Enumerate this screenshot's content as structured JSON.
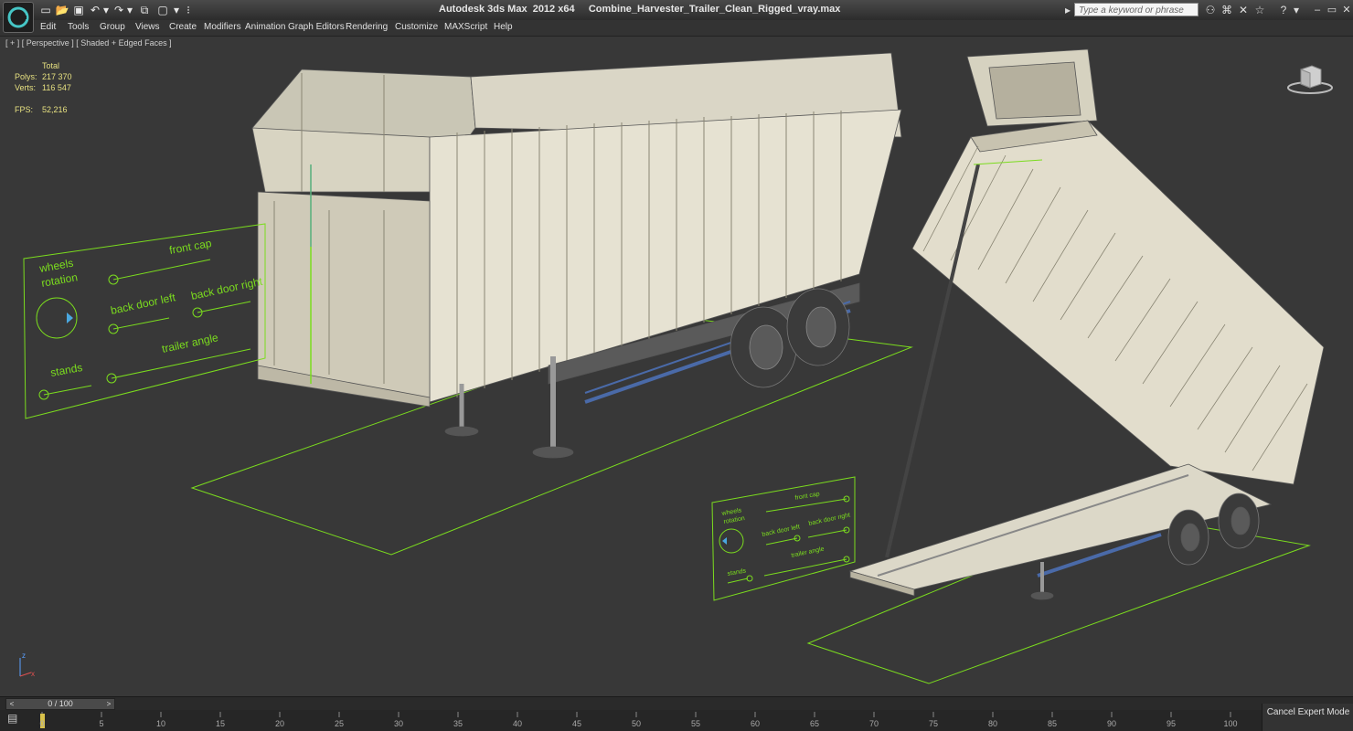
{
  "window": {
    "title": "Autodesk 3ds Max  2012 x64     Combine_Harvester_Trailer_Clean_Rigged_vray.max",
    "search_placeholder": "Type a keyword or phrase",
    "logo_icon": "3ds-max-logo-icon"
  },
  "quick_access": [
    "new-file-icon",
    "open-file-icon",
    "save-icon",
    "undo-icon",
    "redo-icon",
    "project-folder-icon",
    "window-icon"
  ],
  "menu": [
    "Edit",
    "Tools",
    "Group",
    "Views",
    "Create",
    "Modifiers",
    "Animation",
    "Graph Editors",
    "Rendering",
    "Customize",
    "MAXScript",
    "Help"
  ],
  "viewport": {
    "label": "[ + ] [ Perspective ] [ Shaded + Edged Faces ]",
    "stats": {
      "header": "Total",
      "polys_label": "Polys:",
      "polys": "217 370",
      "verts_label": "Verts:",
      "verts": "116 547",
      "fps_label": "FPS:",
      "fps": "52,216"
    },
    "control_panel_left": {
      "labels": [
        "wheels rotation",
        "front cap",
        "back door left",
        "back door right",
        "trailer angle",
        "stands"
      ]
    },
    "control_panel_right": {
      "labels": [
        "wheels rotation",
        "front cap",
        "back door left",
        "back door right",
        "trailer angle",
        "stands"
      ]
    },
    "axis_gizmo": [
      "z",
      "x"
    ]
  },
  "timeline": {
    "frame": "0 / 100",
    "prev": "<",
    "next": ">",
    "ticks": [
      "0",
      "5",
      "10",
      "15",
      "20",
      "25",
      "30",
      "35",
      "40",
      "45",
      "50",
      "55",
      "60",
      "65",
      "70",
      "75",
      "80",
      "85",
      "90",
      "95",
      "100"
    ]
  },
  "status": {
    "cancel_expert": "Cancel Expert Mode"
  },
  "colors": {
    "accent_green": "#7bdc1e",
    "viewport_bg": "#383838",
    "trailer_body": "#d8d4c4"
  }
}
